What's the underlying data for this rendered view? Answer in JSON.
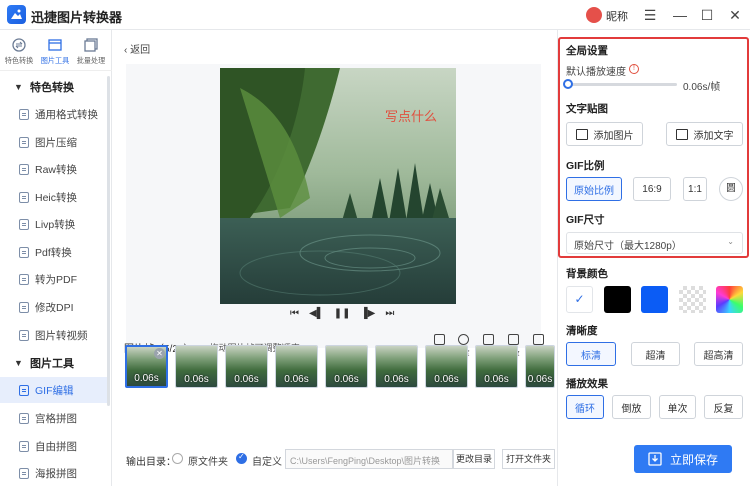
{
  "app": {
    "title": "迅捷图片转换器",
    "nickname": "昵称"
  },
  "window": {
    "menu_icon": "☰",
    "min_icon": "—",
    "max_icon": "☐",
    "close_icon": "✕"
  },
  "nav": {
    "top": [
      {
        "label": "特色转换"
      },
      {
        "label": "图片工具"
      },
      {
        "label": "批量处理"
      }
    ],
    "section_special": "特色转换",
    "section_tools": "图片工具",
    "special_items": [
      "通用格式转换",
      "图片压缩",
      "Raw转换",
      "Heic转换",
      "Livp转换",
      "Pdf转换",
      "转为PDF",
      "修改DPI",
      "图片转视频"
    ],
    "tool_items": [
      "GIF编辑",
      "宫格拼图",
      "自由拼图",
      "海报拼图"
    ]
  },
  "main": {
    "back": "返回",
    "overlay_text": "写点什么",
    "frames_label": "图片帧（5/20）",
    "frames_hint": "•  拖动图片帧可调整顺序",
    "tools": [
      "复制",
      "速度",
      "镜像",
      "倒放",
      "删除"
    ],
    "frames": [
      "0.06s",
      "0.06s",
      "0.06s",
      "0.06s",
      "0.06s",
      "0.06s",
      "0.06s",
      "0.06s",
      "0.06s"
    ],
    "output_label": "输出目录：",
    "radio_original": "原文件夹",
    "radio_custom": "自定义",
    "path": "C:\\Users\\FengPing\\Desktop\\图片转换",
    "change_dir": "更改目录",
    "open_folder": "打开文件夹"
  },
  "panel": {
    "global": "全局设置",
    "speed_label": "默认播放速度",
    "speed_value": "0.06s/帧",
    "speed_fraction": 0.0,
    "sticker": "文字贴图",
    "add_image": "添加图片",
    "add_text": "添加文字",
    "ratio": "GIF比例",
    "ratio_options": [
      "原始比例",
      "16:9",
      "1:1",
      "圆"
    ],
    "size": "GIF尺寸",
    "size_value": "原始尺寸（最大1280p）",
    "bg": "背景颜色",
    "bg_colors": [
      "#ffffff",
      "#000000",
      "#0b5cf5"
    ],
    "clarity": "清晰度",
    "clarity_options": [
      "标清",
      "超清",
      "超高清"
    ],
    "effect": "播放效果",
    "effect_options": [
      "循环",
      "倒放",
      "单次",
      "反复"
    ],
    "save": "立即保存"
  }
}
